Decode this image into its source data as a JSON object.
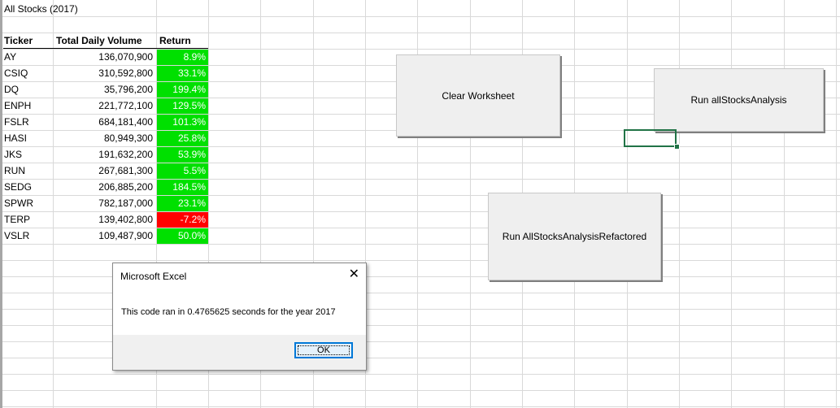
{
  "sheet": {
    "title": "All Stocks (2017)",
    "headers": {
      "ticker": "Ticker",
      "volume": "Total Daily Volume",
      "return": "Return"
    },
    "rows": [
      {
        "ticker": "AY",
        "volume": "136,070,900",
        "return": "8.9%",
        "positive": true
      },
      {
        "ticker": "CSIQ",
        "volume": "310,592,800",
        "return": "33.1%",
        "positive": true
      },
      {
        "ticker": "DQ",
        "volume": "35,796,200",
        "return": "199.4%",
        "positive": true
      },
      {
        "ticker": "ENPH",
        "volume": "221,772,100",
        "return": "129.5%",
        "positive": true
      },
      {
        "ticker": "FSLR",
        "volume": "684,181,400",
        "return": "101.3%",
        "positive": true
      },
      {
        "ticker": "HASI",
        "volume": "80,949,300",
        "return": "25.8%",
        "positive": true
      },
      {
        "ticker": "JKS",
        "volume": "191,632,200",
        "return": "53.9%",
        "positive": true
      },
      {
        "ticker": "RUN",
        "volume": "267,681,300",
        "return": "5.5%",
        "positive": true
      },
      {
        "ticker": "SEDG",
        "volume": "206,885,200",
        "return": "184.5%",
        "positive": true
      },
      {
        "ticker": "SPWR",
        "volume": "782,187,000",
        "return": "23.1%",
        "positive": true
      },
      {
        "ticker": "TERP",
        "volume": "139,402,800",
        "return": "-7.2%",
        "positive": false
      },
      {
        "ticker": "VSLR",
        "volume": "109,487,900",
        "return": "50.0%",
        "positive": true
      }
    ]
  },
  "buttons": {
    "clear": "Clear Worksheet",
    "run_all": "Run allStocksAnalysis",
    "run_refactored": "Run AllStocksAnalysisRefactored"
  },
  "dialog": {
    "title": "Microsoft Excel",
    "close_glyph": "✕",
    "message": "This code ran in 0.4765625 seconds for the year 2017",
    "ok_label": "OK"
  },
  "colors": {
    "positive": "#00e000",
    "negative": "#ff0000",
    "selection": "#217346",
    "ok_border": "#0078d7"
  }
}
